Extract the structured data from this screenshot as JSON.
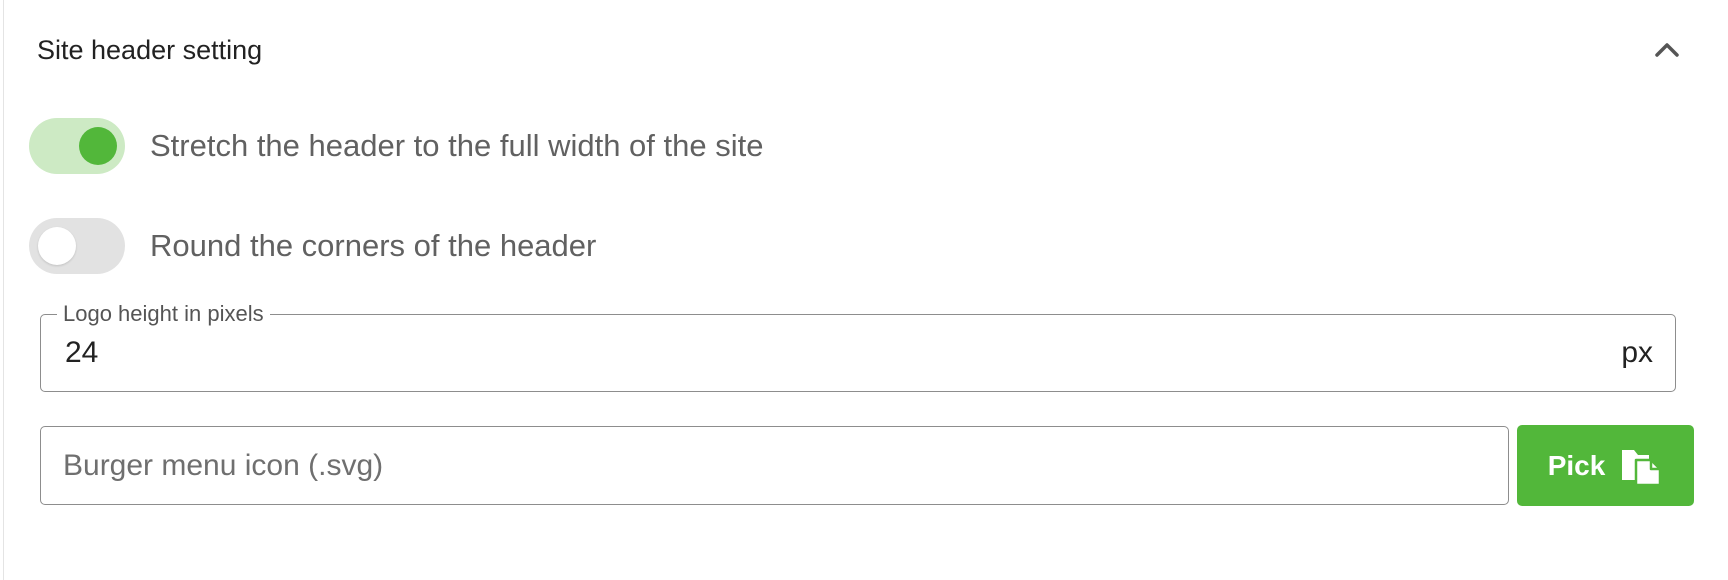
{
  "panel": {
    "title": "Site header setting",
    "collapse_icon": "chevron-up-icon"
  },
  "toggles": [
    {
      "label": "Stretch the header to the full width of the site",
      "checked": true
    },
    {
      "label": "Round the corners of the header",
      "checked": false
    }
  ],
  "logo_height": {
    "label": "Logo height in pixels",
    "value": "24",
    "suffix": "px"
  },
  "burger_icon": {
    "placeholder": "Burger menu icon (.svg)",
    "value": ""
  },
  "pick_button": {
    "label": "Pick",
    "icon": "file-copy-icon"
  },
  "colors": {
    "accent": "#52b73a",
    "switch_track_on": "#cdeac4",
    "switch_track_off": "#e2e2e2",
    "label_text": "#616161"
  }
}
